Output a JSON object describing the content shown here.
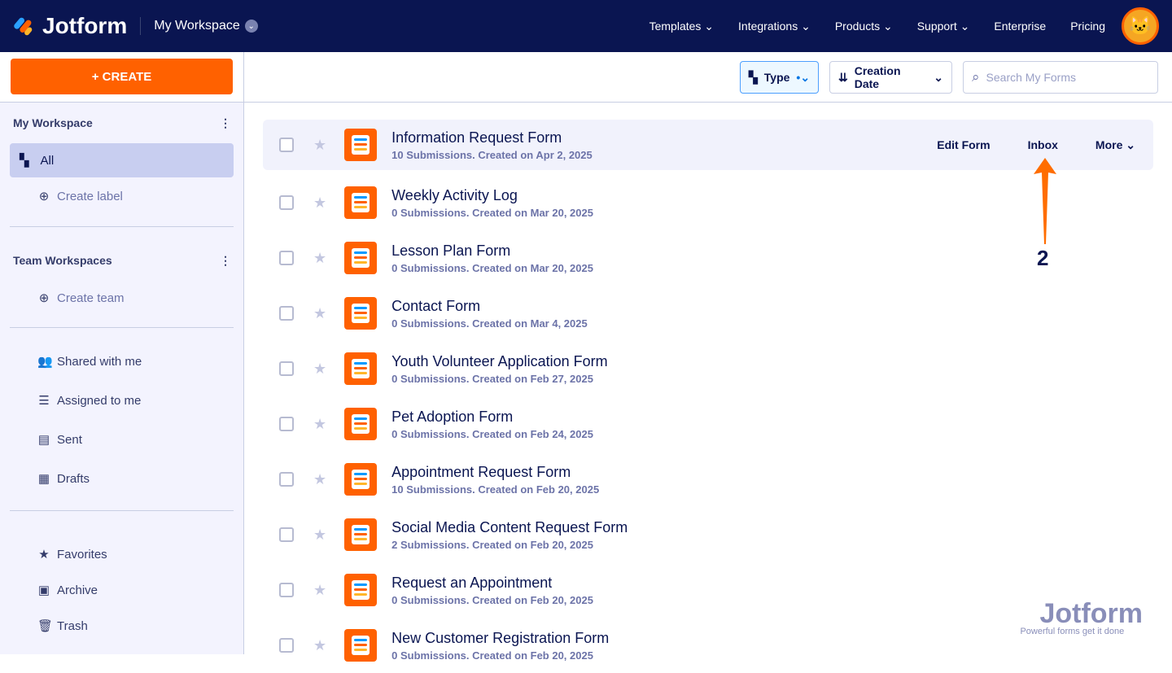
{
  "header": {
    "brand": "Jotform",
    "workspace": "My Workspace",
    "nav": [
      "Templates",
      "Integrations",
      "Products",
      "Support",
      "Enterprise",
      "Pricing"
    ]
  },
  "sidebar": {
    "create": "+ CREATE",
    "my_workspace": "My Workspace",
    "all": "All",
    "create_label": "Create label",
    "team_workspaces": "Team Workspaces",
    "create_team": "Create team",
    "items": [
      "Shared with me",
      "Assigned to me",
      "Sent",
      "Drafts"
    ],
    "bottom": [
      "Favorites",
      "Archive",
      "Trash"
    ]
  },
  "toolbar": {
    "type": "Type",
    "sort": "Creation Date",
    "search_placeholder": "Search My Forms"
  },
  "actions": {
    "edit": "Edit Form",
    "inbox": "Inbox",
    "more": "More"
  },
  "annotation": "2",
  "forms": [
    {
      "title": "Information Request Form",
      "sub": "10 Submissions. Created on Apr 2, 2025"
    },
    {
      "title": "Weekly Activity Log",
      "sub": "0 Submissions. Created on Mar 20, 2025"
    },
    {
      "title": "Lesson Plan Form",
      "sub": "0 Submissions. Created on Mar 20, 2025"
    },
    {
      "title": "Contact Form",
      "sub": "0 Submissions. Created on Mar 4, 2025"
    },
    {
      "title": "Youth Volunteer Application Form",
      "sub": "0 Submissions. Created on Feb 27, 2025"
    },
    {
      "title": "Pet Adoption Form",
      "sub": "0 Submissions. Created on Feb 24, 2025"
    },
    {
      "title": "Appointment Request Form",
      "sub": "10 Submissions. Created on Feb 20, 2025"
    },
    {
      "title": "Social Media Content Request Form",
      "sub": "2 Submissions. Created on Feb 20, 2025"
    },
    {
      "title": "Request an Appointment",
      "sub": "0 Submissions. Created on Feb 20, 2025"
    },
    {
      "title": "New Customer Registration Form",
      "sub": "0 Submissions. Created on Feb 20, 2025"
    }
  ],
  "watermark": {
    "brand": "Jotform",
    "tagline": "Powerful forms get it done"
  }
}
